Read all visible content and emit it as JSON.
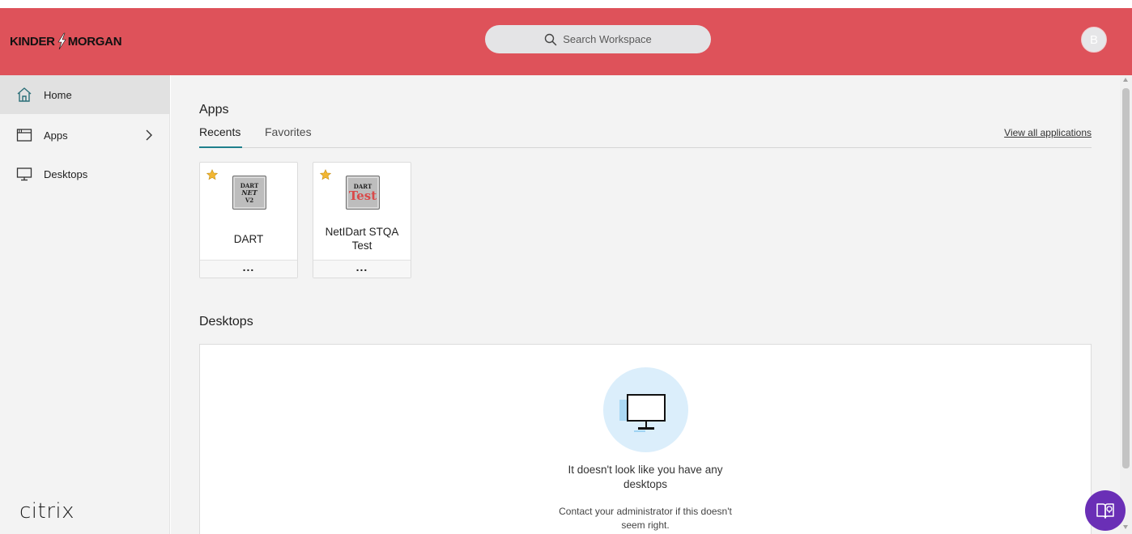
{
  "header": {
    "logo_left": "KINDER",
    "logo_right": "MORGAN",
    "search_placeholder": "Search Workspace",
    "avatar_initial": "B",
    "brand_color": "#de525a"
  },
  "sidebar": {
    "items": [
      {
        "label": "Home",
        "icon": "home-icon",
        "active": true
      },
      {
        "label": "Apps",
        "icon": "apps-window-icon",
        "has_submenu": true
      },
      {
        "label": "Desktops",
        "icon": "monitor-icon"
      }
    ],
    "footer_brand": "citrix"
  },
  "main": {
    "apps_section": {
      "title": "Apps",
      "tabs": [
        {
          "label": "Recents",
          "active": true
        },
        {
          "label": "Favorites",
          "active": false
        }
      ],
      "view_all_label": "View all applications",
      "tiles": [
        {
          "name": "DART",
          "favorite": true,
          "icon_lines": [
            "DART",
            "NET",
            "V2"
          ]
        },
        {
          "name": "NetIDart STQA Test",
          "favorite": true,
          "icon_lines": [
            "DART",
            "Test"
          ]
        }
      ],
      "more_label": "..."
    },
    "desktops_section": {
      "title": "Desktops",
      "empty_title": "It doesn't look like you have any desktops",
      "empty_subtitle": "Contact your administrator if this doesn't seem right."
    }
  },
  "colors": {
    "accent_tab": "#1e7f8c",
    "help_button": "#6a2fb6",
    "empty_circle": "#dbeefb"
  }
}
